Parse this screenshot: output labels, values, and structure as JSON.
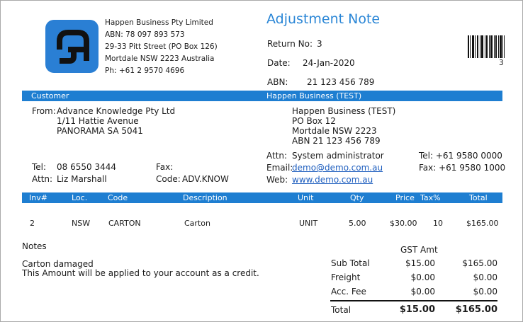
{
  "company": {
    "name": "Happen Business Pty Limited",
    "abn": "ABN: 78 097 893 573",
    "street": "29-33 Pitt Street (PO Box 126)",
    "city": "Mortdale NSW 2223 Australia",
    "phone": "Ph: +61 2 9570 4696"
  },
  "doc": {
    "title": "Adjustment Note",
    "return_label": "Return No:",
    "return_no": "3",
    "date_label": "Date:",
    "date": "24-Jan-2020",
    "abn_label": "ABN:",
    "abn": "21 123 456 789",
    "barcode_number": "3"
  },
  "bar1": {
    "left": "Customer",
    "right": "Happen Business (TEST)"
  },
  "customer": {
    "from_label": "From:",
    "name": "Advance Knowledge Pty Ltd",
    "addr1": "1/11 Hattie Avenue",
    "addr2": "PANORAMA SA 5041",
    "tel_label": "Tel:",
    "tel": "08 6550 3444",
    "fax_label": "Fax:",
    "fax": "",
    "attn_label": "Attn:",
    "attn": "Liz Marshall",
    "code_label": "Code:",
    "code": "ADV.KNOW"
  },
  "supplier": {
    "name": "Happen Business (TEST)",
    "addr1": "PO Box 12",
    "addr2": "Mortdale NSW 2223",
    "abn": "ABN 21 123 456 789",
    "attn_label": "Attn:",
    "attn": "System administrator",
    "email_label": "Email:",
    "email": "demo@demo.com.au",
    "web_label": "Web:",
    "web": "www.demo.com.au",
    "tel": "Tel: +61 9580 0000",
    "fax": "Fax: +61 9580 1000"
  },
  "table": {
    "headers": {
      "inv": "Inv#",
      "loc": "Loc.",
      "code": "Code",
      "desc": "Description",
      "unit": "Unit",
      "qty": "Qty",
      "price": "Price",
      "tax": "Tax%",
      "total": "Total"
    },
    "rows": [
      {
        "inv": "2",
        "loc": "NSW",
        "code": "CARTON",
        "desc": "Carton",
        "unit": "UNIT",
        "qty": "5.00",
        "price": "$30.00",
        "tax": "10",
        "total": "$165.00"
      }
    ]
  },
  "notes": {
    "label": "Notes",
    "line1": "Carton damaged",
    "line2": "This Amount will be applied to your account as a credit."
  },
  "totals": {
    "gst_header": "GST Amt",
    "subtotal_label": "Sub Total",
    "subtotal_gst": "$15.00",
    "subtotal": "$165.00",
    "freight_label": "Freight",
    "freight_gst": "$0.00",
    "freight": "$0.00",
    "fee_label": "Acc. Fee",
    "fee_gst": "$0.00",
    "fee": "$0.00",
    "total_label": "Total",
    "total_gst": "$15.00",
    "total": "$165.00"
  }
}
